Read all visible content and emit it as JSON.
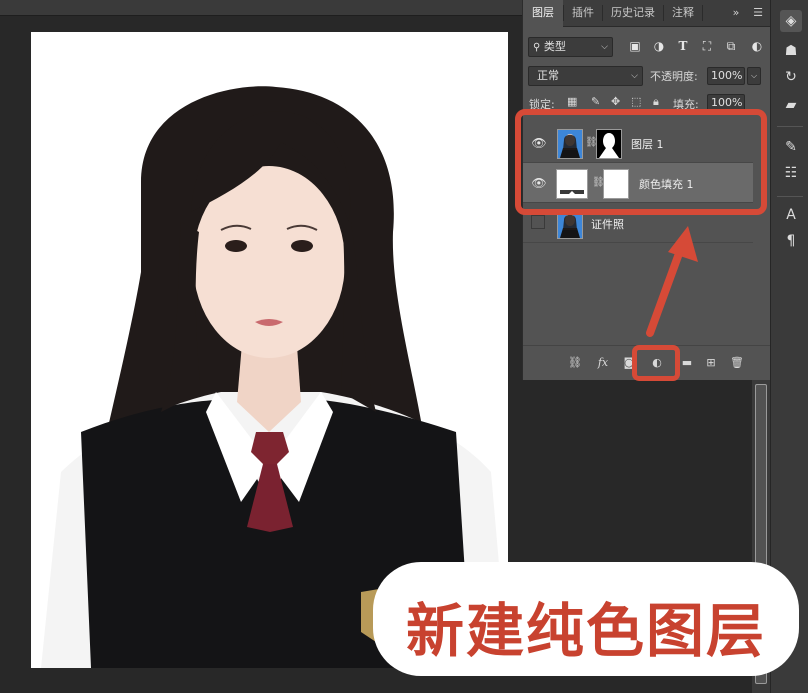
{
  "panel": {
    "tabs": [
      {
        "label": "图层",
        "active": true
      },
      {
        "label": "插件",
        "active": false
      },
      {
        "label": "历史记录",
        "active": false
      },
      {
        "label": "注释",
        "active": false
      }
    ],
    "tab_overflow": "»",
    "tab_menu": "☰",
    "filter": {
      "label": "类型",
      "icons": [
        "image-filter-icon",
        "adjustment-filter-icon",
        "type-filter-icon",
        "shape-filter-icon",
        "smart-object-filter-icon",
        "filter-toggle-icon"
      ]
    },
    "blend_mode": "正常",
    "opacity_label": "不透明度:",
    "opacity_value": "100%",
    "lock_label": "锁定:",
    "fill_label": "填充:",
    "fill_value": "100%",
    "layers": [
      {
        "name": "图层 1",
        "visible": true,
        "selected": false,
        "thumb": "photo",
        "has_mask": true
      },
      {
        "name": "颜色填充 1",
        "visible": true,
        "selected": true,
        "thumb": "white",
        "has_mask": true
      },
      {
        "name": "证件照",
        "visible": false,
        "selected": false,
        "thumb": "photo",
        "has_mask": false
      }
    ],
    "bottom_icons": [
      "link-layers-icon",
      "fx-icon",
      "add-mask-icon",
      "new-fill-adjustment-icon",
      "new-group-icon",
      "new-layer-icon",
      "delete-layer-icon"
    ],
    "fx_label": "fx"
  },
  "right_toolbar": [
    "layers-panel-icon",
    "libraries-icon",
    "history-icon",
    "comments-icon",
    "brush-icon",
    "adjustments-icon",
    "character-icon",
    "paragraph-icon"
  ],
  "annotation": {
    "caption": "新建纯色图层",
    "color": "#d64a37"
  }
}
